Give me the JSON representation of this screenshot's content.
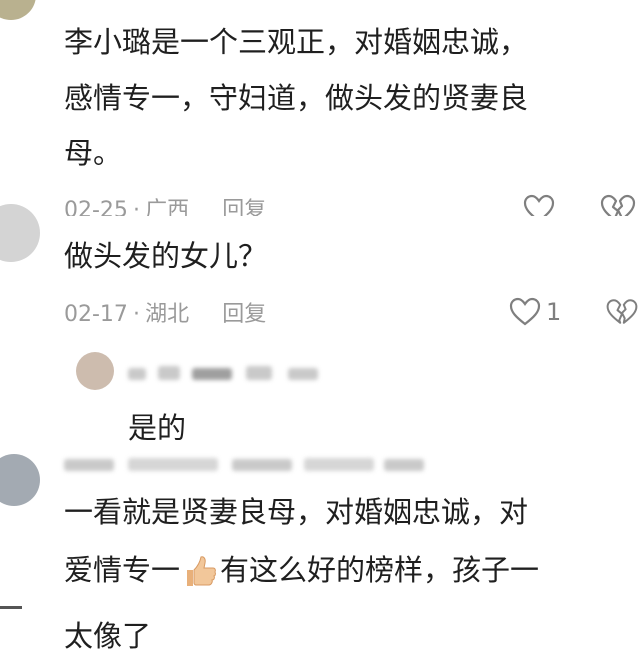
{
  "comment1": {
    "lines": [
      "李小璐是一个三观正，对婚姻忠诚，",
      "感情专一，守妇道，做头发的贤妻良",
      "母。"
    ],
    "date": "02-25",
    "location": "广西",
    "reply_label": "回复"
  },
  "comment2": {
    "text": "做头发的女儿？",
    "date": "02-17",
    "location": "湖北",
    "reply_label": "回复",
    "like_count": "1"
  },
  "comment3": {
    "text": "是的"
  },
  "comment4": {
    "line1": "一看就是贤妻良母，对婚姻忠诚，对",
    "line2_part1": "爱情专一",
    "line2_part2": "有这么好的榜样，孩子一",
    "line3": "太像了"
  },
  "separators": {
    "dot": "·"
  },
  "colors": {
    "meta_gray": "#9a9a9a",
    "icon_gray": "#7f7f7f",
    "thumb": "#f2c79a"
  },
  "icons": [
    "heart-outline-icon",
    "broken-heart-icon",
    "thumbs-up-emoji"
  ]
}
